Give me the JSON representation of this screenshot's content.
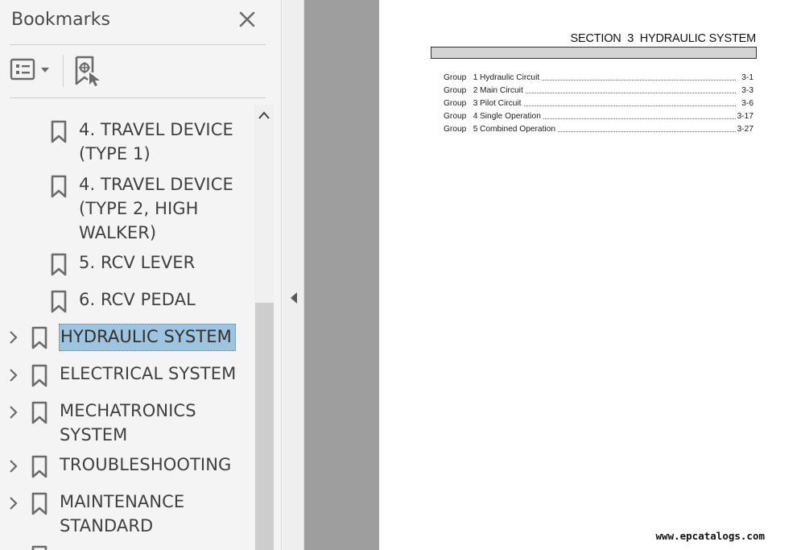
{
  "bookmarks_panel": {
    "title": "Bookmarks",
    "close_icon": "close-icon",
    "options_icon": "list-options-icon",
    "new_bookmark_icon": "new-bookmark-icon"
  },
  "tree": {
    "items": [
      {
        "label": "4. TRAVEL DEVICE\n(TYPE 1)",
        "level": 1,
        "has_children": false,
        "selected": false
      },
      {
        "label": "4. TRAVEL DEVICE\n(TYPE 2, HIGH\nWALKER)",
        "level": 1,
        "has_children": false,
        "selected": false
      },
      {
        "label": "5. RCV LEVER",
        "level": 1,
        "has_children": false,
        "selected": false
      },
      {
        "label": "6. RCV PEDAL",
        "level": 1,
        "has_children": false,
        "selected": false
      },
      {
        "label": "HYDRAULIC SYSTEM",
        "level": 0,
        "has_children": true,
        "selected": true
      },
      {
        "label": "ELECTRICAL SYSTEM",
        "level": 0,
        "has_children": true,
        "selected": false
      },
      {
        "label": "MECHATRONICS\nSYSTEM",
        "level": 0,
        "has_children": true,
        "selected": false
      },
      {
        "label": "TROUBLESHOOTING",
        "level": 0,
        "has_children": true,
        "selected": false
      },
      {
        "label": "MAINTENANCE\nSTANDARD",
        "level": 0,
        "has_children": true,
        "selected": false
      }
    ]
  },
  "document": {
    "section_title": "SECTION  3  HYDRAULIC SYSTEM",
    "toc": [
      {
        "group": "Group   1",
        "title": "Hydraulic Circuit",
        "page": "3-1"
      },
      {
        "group": "Group   2",
        "title": "Main Circuit",
        "page": "3-3"
      },
      {
        "group": "Group   3",
        "title": "Pilot Circuit",
        "page": "3-6"
      },
      {
        "group": "Group   4",
        "title": "Single Operation",
        "page": "3-17"
      },
      {
        "group": "Group   5",
        "title": "Combined Operation",
        "page": "3-27"
      }
    ],
    "watermark": "www.epcatalogs.com"
  },
  "colors": {
    "selection": "#9ec4df",
    "panel_bg": "#f4f4f4",
    "doc_gray": "#9e9e9e",
    "icon_gray": "#6b6b6b"
  }
}
